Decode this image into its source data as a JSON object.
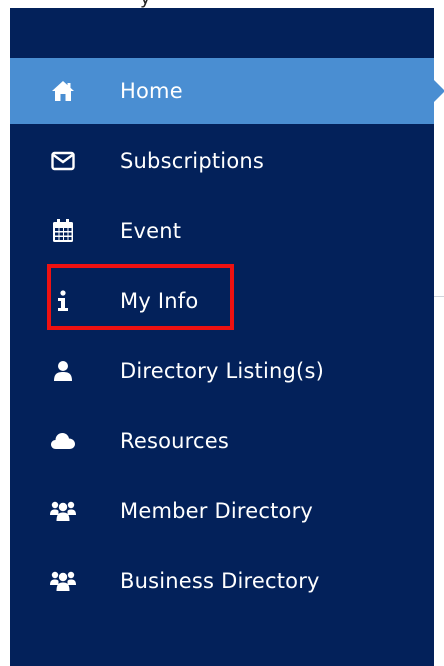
{
  "header": {
    "partial_text": "y"
  },
  "sidebar": {
    "items": [
      {
        "label": "Home",
        "icon": "home-icon",
        "active": true
      },
      {
        "label": "Subscriptions",
        "icon": "envelope-icon",
        "active": false
      },
      {
        "label": "Event",
        "icon": "calendar-icon",
        "active": false
      },
      {
        "label": "My Info",
        "icon": "info-icon",
        "active": false
      },
      {
        "label": "Directory Listing(s)",
        "icon": "user-icon",
        "active": false
      },
      {
        "label": "Resources",
        "icon": "cloud-icon",
        "active": false
      },
      {
        "label": "Member Directory",
        "icon": "users-icon",
        "active": false
      },
      {
        "label": "Business Directory",
        "icon": "users-icon",
        "active": false
      }
    ]
  },
  "colors": {
    "sidebar_bg": "#03215a",
    "active_bg": "#4a8ed2",
    "highlight": "#ee1111"
  }
}
